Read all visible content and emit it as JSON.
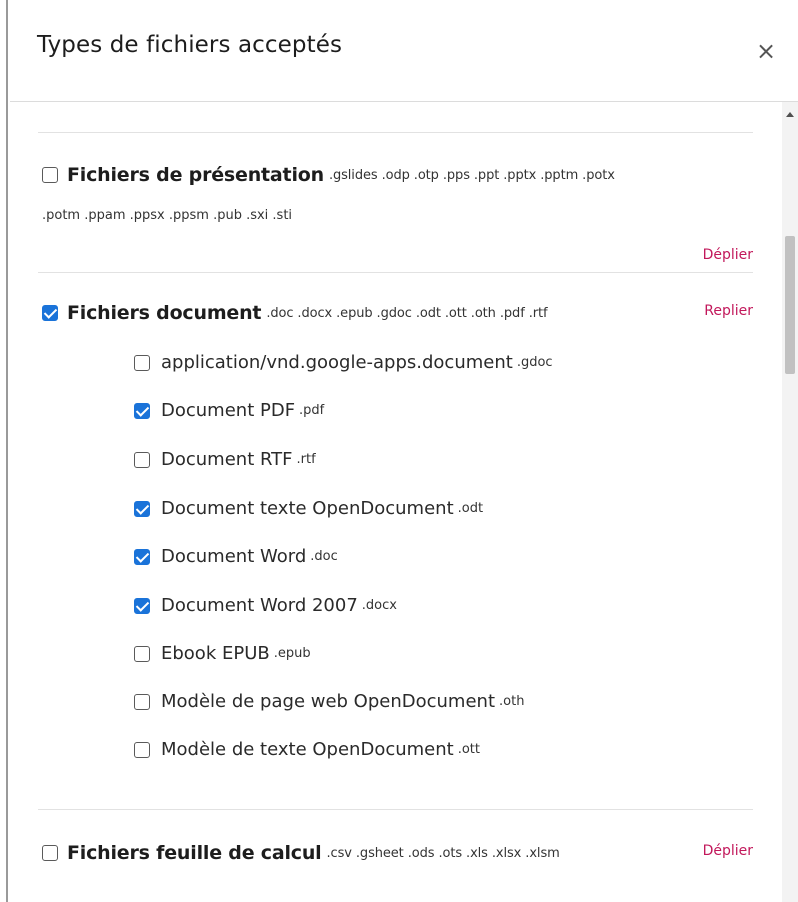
{
  "modal": {
    "title": "Types de fichiers acceptés",
    "close_symbol": "×"
  },
  "groups": {
    "presentation": {
      "checked": false,
      "title": "Fichiers de présentation",
      "extensions_line1": ".gslides .odp .otp .pps .ppt .pptx .pptm .potx",
      "extensions_line2": ".potm .ppam .ppsx .ppsm .pub .sxi .sti",
      "toggle_label": "Déplier"
    },
    "document": {
      "checked": true,
      "title": "Fichiers document",
      "extensions": ".doc .docx .epub .gdoc .odt .ott .oth .pdf .rtf",
      "toggle_label": "Replier",
      "items": [
        {
          "label": "application/vnd.google-apps.document",
          "ext": ".gdoc",
          "checked": false
        },
        {
          "label": "Document PDF",
          "ext": ".pdf",
          "checked": true
        },
        {
          "label": "Document RTF",
          "ext": ".rtf",
          "checked": false
        },
        {
          "label": "Document texte OpenDocument",
          "ext": ".odt",
          "checked": true
        },
        {
          "label": "Document Word",
          "ext": ".doc",
          "checked": true
        },
        {
          "label": "Document Word 2007",
          "ext": ".docx",
          "checked": true
        },
        {
          "label": "Ebook EPUB",
          "ext": ".epub",
          "checked": false
        },
        {
          "label": "Modèle de page web OpenDocument",
          "ext": ".oth",
          "checked": false
        },
        {
          "label": "Modèle de texte OpenDocument",
          "ext": ".ott",
          "checked": false
        }
      ]
    },
    "spreadsheet": {
      "checked": false,
      "title": "Fichiers feuille de calcul",
      "extensions": ".csv .gsheet .ods .ots .xls .xlsx .xlsm",
      "toggle_label": "Déplier"
    }
  },
  "colors": {
    "accent_link": "#c2185b",
    "checkbox_checked": "#1a73d9"
  }
}
